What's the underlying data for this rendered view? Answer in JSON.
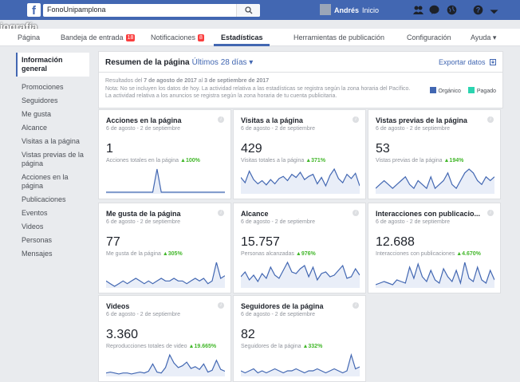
{
  "topbar": {
    "page_search": "FonoUnipamplona",
    "user_name": "Andrés",
    "home_label": "Inicio"
  },
  "page_header": {
    "name_fragment": "iografía"
  },
  "subnav": {
    "items": [
      {
        "label": "Página"
      },
      {
        "label": "Bandeja de entrada",
        "badge": "18"
      },
      {
        "label": "Notificaciones",
        "badge": "8"
      },
      {
        "label": "Estadísticas"
      },
      {
        "label": "Herramientas de publicación"
      }
    ],
    "settings_label": "Configuración",
    "help_label": "Ayuda ▾"
  },
  "sidebar": {
    "items": [
      {
        "label": "Información general"
      },
      {
        "label": "Promociones"
      },
      {
        "label": "Seguidores"
      },
      {
        "label": "Me gusta"
      },
      {
        "label": "Alcance"
      },
      {
        "label": "Visitas a la página"
      },
      {
        "label": "Vistas previas de la página"
      },
      {
        "label": "Acciones en la página"
      },
      {
        "label": "Publicaciones"
      },
      {
        "label": "Eventos"
      },
      {
        "label": "Videos"
      },
      {
        "label": "Personas"
      },
      {
        "label": "Mensajes"
      }
    ]
  },
  "summary": {
    "title": "Resumen de la página",
    "range": "Últimos 28 días ▾",
    "export_label": "Exportar datos",
    "notes_prefix": "Resultados del",
    "notes_start": "7 de agosto de 2017",
    "notes_mid": "al",
    "notes_end": "3 de septiembre de 2017",
    "notes_detail": "Nota: No se incluyen los datos de hoy. La actividad relativa a las estadísticas se registra según la zona horaria del Pacífico. La actividad relativa a los anuncios se registra según la zona horaria de tu cuenta publicitaria.",
    "legend": [
      {
        "label": "Orgánico",
        "color": "#4267b2"
      },
      {
        "label": "Pagado",
        "color": "#2bd4b0"
      }
    ]
  },
  "cards": [
    {
      "title": "Acciones en la página",
      "date": "6 de agosto - 2 de septiembre",
      "value": "1",
      "sub": "Acciones totales en la página",
      "change": "▲100%",
      "series": [
        0,
        0,
        0,
        0,
        0,
        0,
        0,
        0,
        0,
        0,
        0,
        0,
        10,
        0,
        0,
        0,
        0,
        0,
        0,
        0,
        0,
        0,
        0,
        0,
        0,
        0,
        0,
        0,
        0
      ]
    },
    {
      "title": "Visitas a la página",
      "date": "6 de agosto - 2 de septiembre",
      "value": "429",
      "sub": "Visitas totales a la página",
      "change": "▲371%",
      "series": [
        14,
        9,
        20,
        12,
        8,
        11,
        7,
        12,
        8,
        13,
        15,
        11,
        17,
        14,
        19,
        12,
        15,
        17,
        8,
        14,
        6,
        16,
        22,
        13,
        9,
        17,
        13,
        18,
        6
      ]
    },
    {
      "title": "Vistas previas de la página",
      "date": "6 de agosto - 2 de septiembre",
      "value": "53",
      "sub": "Vistas previas de la página",
      "change": "▲194%",
      "series": [
        1,
        2,
        3,
        2,
        1,
        2,
        3,
        4,
        2,
        1,
        3,
        2,
        1,
        4,
        1,
        2,
        3,
        5,
        2,
        1,
        3,
        5,
        6,
        5,
        3,
        2,
        4,
        3,
        4
      ]
    },
    {
      "title": "Me gusta de la página",
      "date": "6 de agosto - 2 de septiembre",
      "value": "77",
      "sub": "Me gusta de la página",
      "change": "▲305%",
      "series": [
        2,
        1,
        0,
        1,
        2,
        1,
        2,
        3,
        2,
        1,
        2,
        1,
        2,
        3,
        2,
        2,
        3,
        2,
        2,
        1,
        2,
        3,
        2,
        3,
        1,
        2,
        9,
        3,
        4
      ]
    },
    {
      "title": "Alcance",
      "date": "6 de agosto - 2 de septiembre",
      "value": "15.757",
      "sub": "Personas alcanzadas",
      "change": "▲976%",
      "series": [
        6,
        9,
        4,
        7,
        3,
        8,
        5,
        12,
        7,
        5,
        10,
        15,
        9,
        8,
        11,
        13,
        6,
        12,
        4,
        8,
        9,
        6,
        7,
        10,
        13,
        5,
        6,
        11,
        7
      ]
    },
    {
      "title": "Interacciones con publicacio...",
      "date": "6 de agosto - 2 de septiembre",
      "value": "12.688",
      "sub": "Interacciones con publicaciones",
      "change": "▲4.670%",
      "series": [
        1,
        2,
        3,
        2,
        1,
        4,
        3,
        2,
        12,
        5,
        14,
        6,
        3,
        10,
        4,
        2,
        11,
        6,
        3,
        10,
        2,
        15,
        5,
        3,
        12,
        4,
        2,
        10,
        4
      ]
    },
    {
      "title": "Videos",
      "date": "6 de agosto - 2 de septiembre",
      "value": "3.360",
      "sub": "Reproducciones totales de video",
      "change": "▲19.665%",
      "series": [
        2,
        3,
        2,
        1,
        2,
        2,
        1,
        2,
        3,
        2,
        4,
        12,
        3,
        2,
        8,
        22,
        13,
        8,
        10,
        14,
        7,
        9,
        6,
        12,
        3,
        5,
        16,
        6,
        4
      ]
    },
    {
      "title": "Seguidores de la página",
      "date": "6 de agosto - 2 de septiembre",
      "value": "82",
      "sub": "Seguidores de la página",
      "change": "▲332%",
      "series": [
        2,
        1,
        2,
        3,
        1,
        2,
        1,
        2,
        3,
        2,
        1,
        2,
        2,
        3,
        2,
        1,
        2,
        2,
        3,
        2,
        1,
        2,
        3,
        2,
        1,
        2,
        10,
        3,
        4
      ]
    }
  ]
}
